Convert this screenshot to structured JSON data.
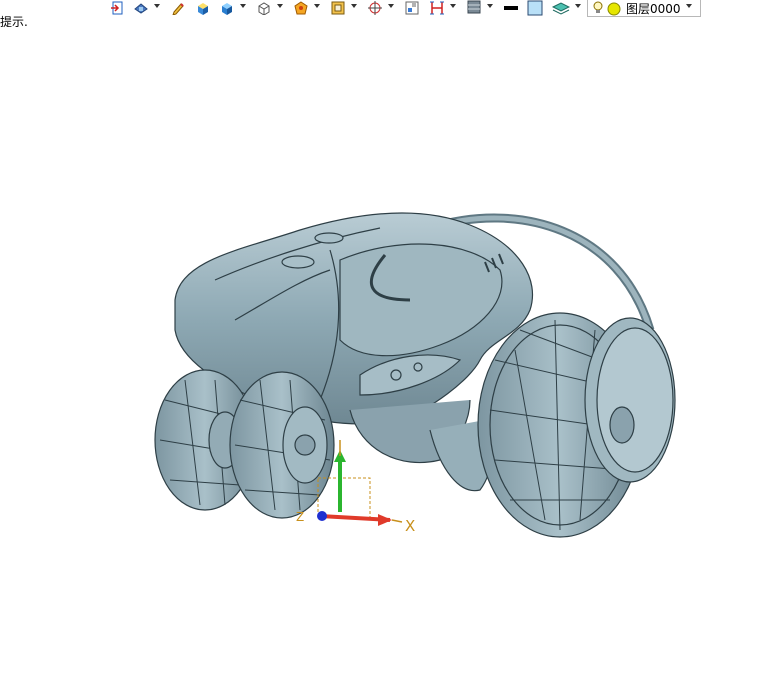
{
  "hint_text": "提示.",
  "layer": {
    "name": "图层0000"
  },
  "axes": {
    "x_label": "X",
    "z_label": "Z"
  },
  "colors": {
    "model": "#8fa9b4",
    "model_dark": "#2e3f46",
    "axis_x": "#e03a2a",
    "axis_y": "#2bb52f",
    "axis_z": "#1f2fd0",
    "axis_label": "#c8901c"
  },
  "toolbar": {
    "icons": [
      "exit-icon",
      "view-icon",
      "pencil-icon",
      "solid-box-icon",
      "cube-blue-icon",
      "wireframe-cube-icon",
      "render-sphere-icon",
      "frame-icon",
      "snap-target-icon",
      "grid-view-icon",
      "measure-icon",
      "layer-stack-icon",
      "line-color-icon",
      "fill-color-icon",
      "layer-manager-icon",
      "bulb-icon"
    ]
  }
}
